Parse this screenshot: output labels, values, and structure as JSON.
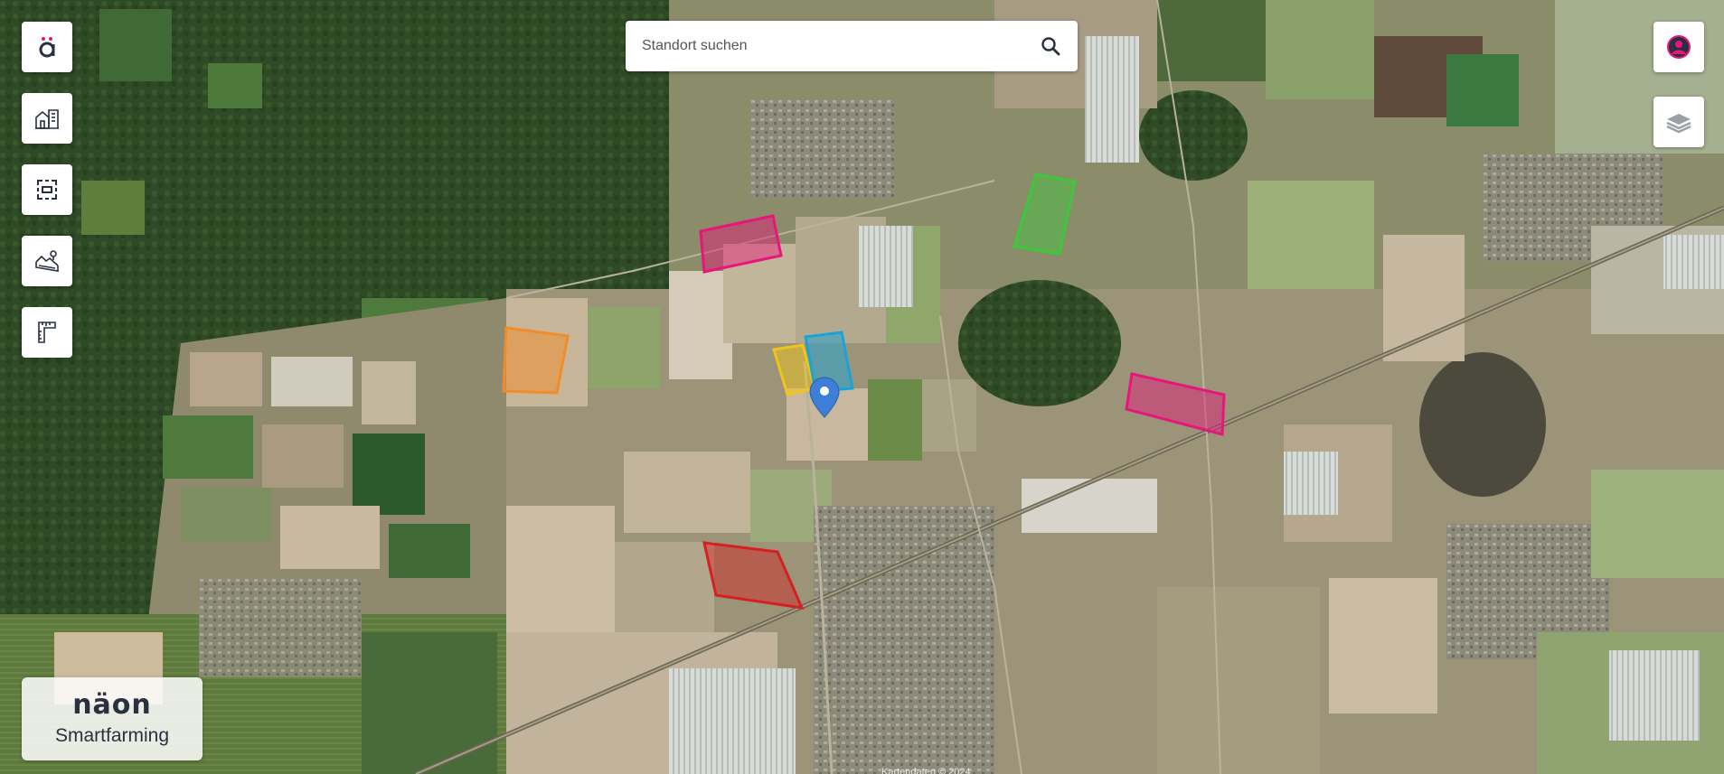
{
  "app": {
    "logo_icon": "a-umlaut-logo-icon",
    "brand_logo_text": "näon",
    "brand_subtitle": "Smartfarming"
  },
  "search": {
    "placeholder": "Standort suchen",
    "value": "",
    "icon": "search-icon"
  },
  "toolbar": {
    "items": [
      {
        "name": "logo-button",
        "icon": "a-umlaut-logo-icon"
      },
      {
        "name": "buildings-button",
        "icon": "buildings-icon"
      },
      {
        "name": "area-select-button",
        "icon": "dashed-frame-icon"
      },
      {
        "name": "terrain-button",
        "icon": "terrain-icon"
      },
      {
        "name": "measure-button",
        "icon": "ruler-icon"
      }
    ]
  },
  "right_controls": {
    "profile_icon": "user-avatar-icon",
    "layers_icon": "layers-icon"
  },
  "map": {
    "type": "satellite",
    "attribution": "Kartendaten © 2024",
    "field_colors": [
      "#e8157a",
      "#f28c28",
      "#f0c419",
      "#1aa3d9",
      "#3cc83c",
      "#d42020"
    ],
    "marker_color": "#3d7fd6"
  }
}
